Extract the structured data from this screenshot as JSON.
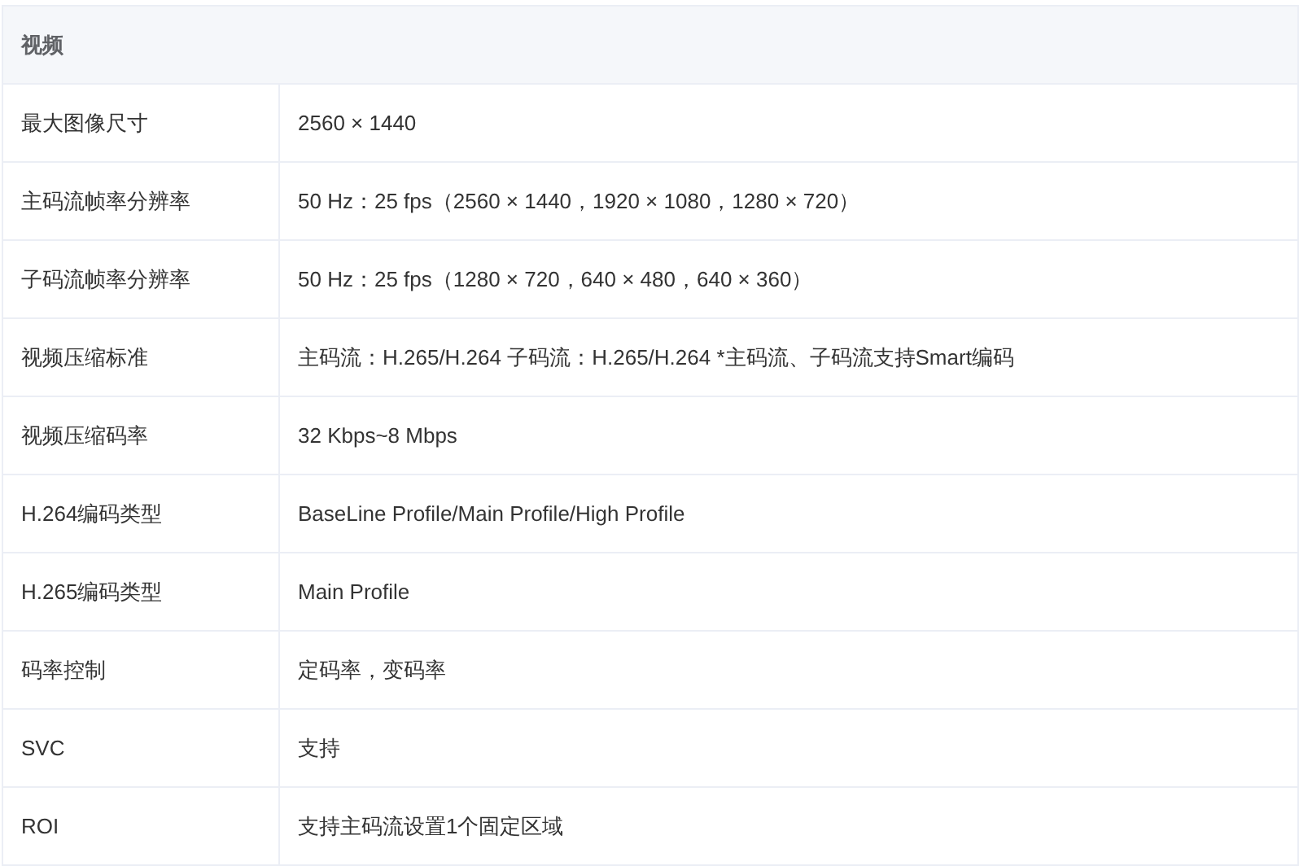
{
  "table": {
    "title": "视频",
    "rows": [
      {
        "label": "最大图像尺寸",
        "value": "2560 × 1440"
      },
      {
        "label": "主码流帧率分辨率",
        "value": "50 Hz：25 fps（2560 × 1440，1920 × 1080，1280 × 720）"
      },
      {
        "label": "子码流帧率分辨率",
        "value": "50 Hz：25 fps（1280 × 720，640 × 480，640 × 360）"
      },
      {
        "label": "视频压缩标准",
        "value": "主码流：H.265/H.264 子码流：H.265/H.264 *主码流、子码流支持Smart编码"
      },
      {
        "label": "视频压缩码率",
        "value": "32 Kbps~8 Mbps"
      },
      {
        "label": "H.264编码类型",
        "value": "BaseLine Profile/Main Profile/High Profile"
      },
      {
        "label": "H.265编码类型",
        "value": "Main Profile"
      },
      {
        "label": "码率控制",
        "value": "定码率，变码率"
      },
      {
        "label": "SVC",
        "value": "支持"
      },
      {
        "label": "ROI",
        "value": "支持主码流设置1个固定区域"
      }
    ]
  }
}
